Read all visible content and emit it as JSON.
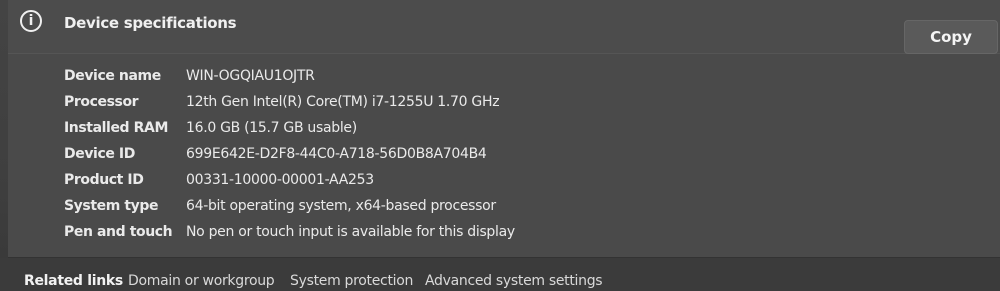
{
  "header": {
    "icon": "info-icon",
    "title": "Device specifications",
    "copy_label": "Copy"
  },
  "specs": [
    {
      "label": "Device name",
      "value": "WIN-OGQIAU1OJTR"
    },
    {
      "label": "Processor",
      "value": "12th Gen Intel(R) Core(TM) i7-1255U   1.70 GHz"
    },
    {
      "label": "Installed RAM",
      "value": "16.0 GB (15.7 GB usable)"
    },
    {
      "label": "Device ID",
      "value": "699E642E-D2F8-44C0-A718-56D0B8A704B4"
    },
    {
      "label": "Product ID",
      "value": "00331-10000-00001-AA253"
    },
    {
      "label": "System type",
      "value": "64-bit operating system, x64-based processor"
    },
    {
      "label": "Pen and touch",
      "value": "No pen or touch input is available for this display"
    }
  ],
  "related": {
    "title": "Related links",
    "links": [
      "Domain or workgroup",
      "System protection",
      "Advanced system settings"
    ]
  }
}
